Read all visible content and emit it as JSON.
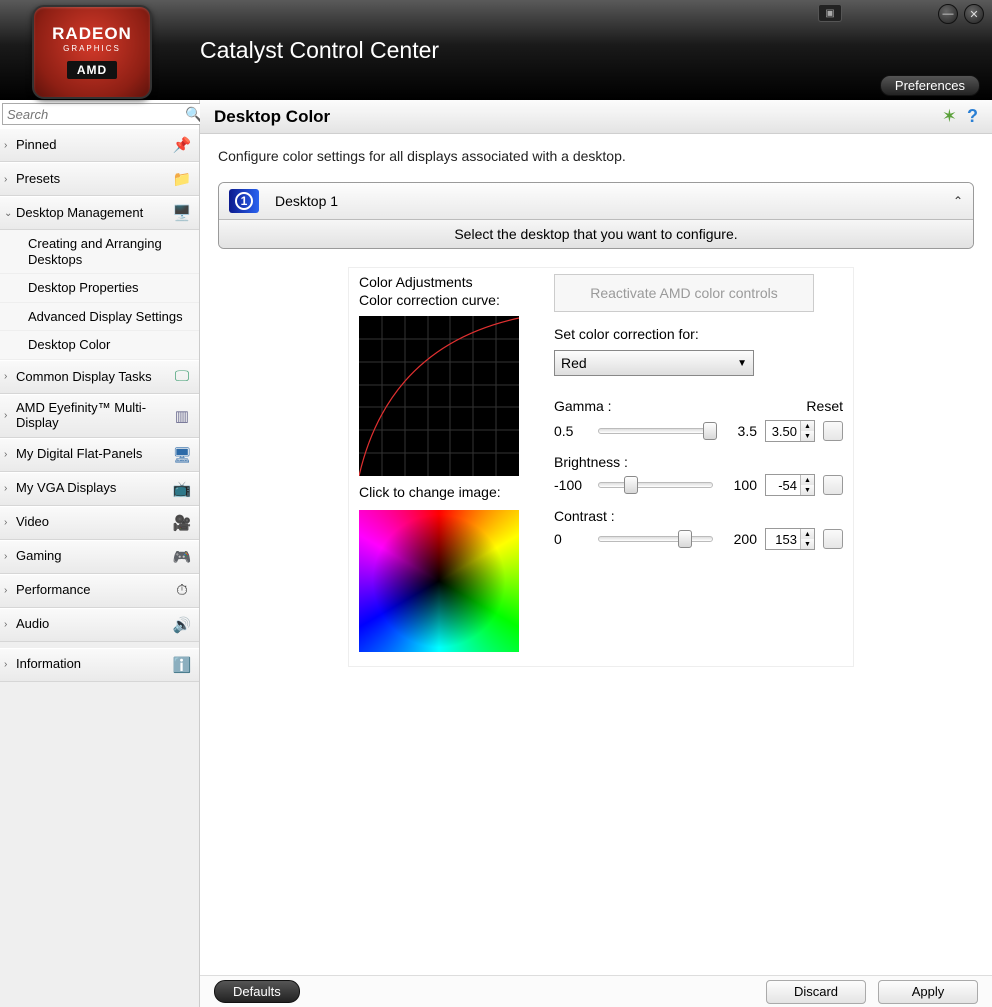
{
  "header": {
    "logo_line1": "RADEON",
    "logo_line2": "GRAPHICS",
    "logo_brand": "AMD",
    "app_title": "Catalyst Control Center",
    "preferences": "Preferences"
  },
  "sidebar": {
    "search_placeholder": "Search",
    "items": [
      {
        "label": "Pinned",
        "expanded": false
      },
      {
        "label": "Presets",
        "expanded": false
      },
      {
        "label": "Desktop Management",
        "expanded": true,
        "children": [
          "Creating and Arranging Desktops",
          "Desktop Properties",
          "Advanced Display Settings",
          "Desktop Color"
        ]
      },
      {
        "label": "Common Display Tasks",
        "expanded": false
      },
      {
        "label": "AMD Eyefinity™ Multi-Display",
        "expanded": false
      },
      {
        "label": "My Digital Flat-Panels",
        "expanded": false
      },
      {
        "label": "My VGA Displays",
        "expanded": false
      },
      {
        "label": "Video",
        "expanded": false
      },
      {
        "label": "Gaming",
        "expanded": false
      },
      {
        "label": "Performance",
        "expanded": false
      },
      {
        "label": "Audio",
        "expanded": false
      },
      {
        "label": "Information",
        "expanded": false
      }
    ]
  },
  "page": {
    "title": "Desktop Color",
    "description": "Configure color settings for all displays associated with a desktop.",
    "desktop_selector": {
      "badge": "1",
      "label": "Desktop 1",
      "hint": "Select the desktop that you want to configure."
    },
    "group_title": "Color Adjustments",
    "curve_label": "Color correction curve:",
    "change_image_label": "Click to change image:",
    "reactivate_label": "Reactivate AMD color controls",
    "set_for_label": "Set color correction for:",
    "channel": "Red",
    "reset_label": "Reset",
    "gamma": {
      "label": "Gamma :",
      "min": "0.5",
      "max": "3.5",
      "value": "3.50",
      "pos": 92
    },
    "brightness": {
      "label": "Brightness :",
      "min": "-100",
      "max": "100",
      "value": "-54",
      "pos": 22
    },
    "contrast": {
      "label": "Contrast :",
      "min": "0",
      "max": "200",
      "value": "153",
      "pos": 70
    }
  },
  "footer": {
    "defaults": "Defaults",
    "discard": "Discard",
    "apply": "Apply"
  }
}
